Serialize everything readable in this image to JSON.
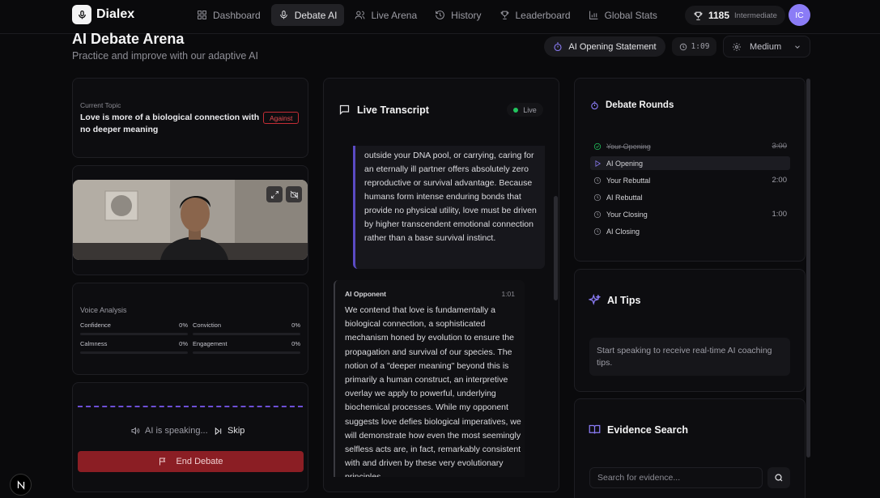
{
  "app": {
    "name": "Dialex",
    "logo_icon": "mic-icon"
  },
  "nav": {
    "items": [
      {
        "label": "Dashboard",
        "icon": "grid-icon",
        "active": false
      },
      {
        "label": "Debate AI",
        "icon": "mic-icon",
        "active": true
      },
      {
        "label": "Live Arena",
        "icon": "users-icon",
        "active": false
      },
      {
        "label": "History",
        "icon": "history-icon",
        "active": false
      },
      {
        "label": "Leaderboard",
        "icon": "trophy-icon",
        "active": false
      },
      {
        "label": "Global Stats",
        "icon": "bar-chart-icon",
        "active": false
      }
    ],
    "score": "1185",
    "level": "Intermediate",
    "avatar_initials": "IC"
  },
  "header": {
    "title": "AI Debate Arena",
    "subtitle": "Practice and improve with our adaptive AI",
    "phase": "AI Opening Statement",
    "timer": "1:09",
    "difficulty": "Medium"
  },
  "topic": {
    "label": "Current Topic",
    "text": "Love is more of a biological connection with no deeper meaning",
    "stance": "Against"
  },
  "voice_analysis": {
    "title": "Voice Analysis",
    "metrics": [
      {
        "label": "Confidence",
        "value": "0%"
      },
      {
        "label": "Conviction",
        "value": "0%"
      },
      {
        "label": "Calmness",
        "value": "0%"
      },
      {
        "label": "Engagement",
        "value": "0%"
      }
    ]
  },
  "controls": {
    "status": "AI is speaking...",
    "skip_label": "Skip",
    "end_label": "End Debate"
  },
  "transcript": {
    "title": "Live Transcript",
    "live_label": "Live",
    "user_message": "outside your DNA pool, or carrying, caring for an eternally ill partner offers absolutely zero reproductive or survival advantage. Because humans form intense enduring bonds that provide no physical utility, love must be driven by higher transcendent emotional connection rather than a base survival instinct.",
    "ai_message": {
      "speaker": "AI Opponent",
      "time": "1:01",
      "text": "We contend that love is fundamentally a biological connection, a sophisticated mechanism honed by evolution to ensure the propagation and survival of our species. The notion of a \"deeper meaning\" beyond this is primarily a human construct, an interpretive overlay we apply to powerful, underlying biochemical processes. While my opponent suggests love defies biological imperatives, we will demonstrate how even the most seemingly selfless acts are, in fact, remarkably consistent with and driven by these very evolutionary principles"
    }
  },
  "rounds": {
    "title": "Debate Rounds",
    "items": [
      {
        "name": "Your Opening",
        "time": "3:00",
        "state": "done"
      },
      {
        "name": "AI Opening",
        "time": "",
        "state": "active"
      },
      {
        "name": "Your Rebuttal",
        "time": "2:00",
        "state": "pending"
      },
      {
        "name": "AI Rebuttal",
        "time": "",
        "state": "pending"
      },
      {
        "name": "Your Closing",
        "time": "1:00",
        "state": "pending"
      },
      {
        "name": "AI Closing",
        "time": "",
        "state": "pending"
      }
    ]
  },
  "tips": {
    "title": "AI Tips",
    "text": "Start speaking to receive real-time AI coaching tips."
  },
  "evidence": {
    "title": "Evidence Search",
    "placeholder": "Search for evidence..."
  },
  "colors": {
    "accent": "#6d4fd6",
    "danger": "#8b1e24",
    "live": "#22c55e"
  }
}
